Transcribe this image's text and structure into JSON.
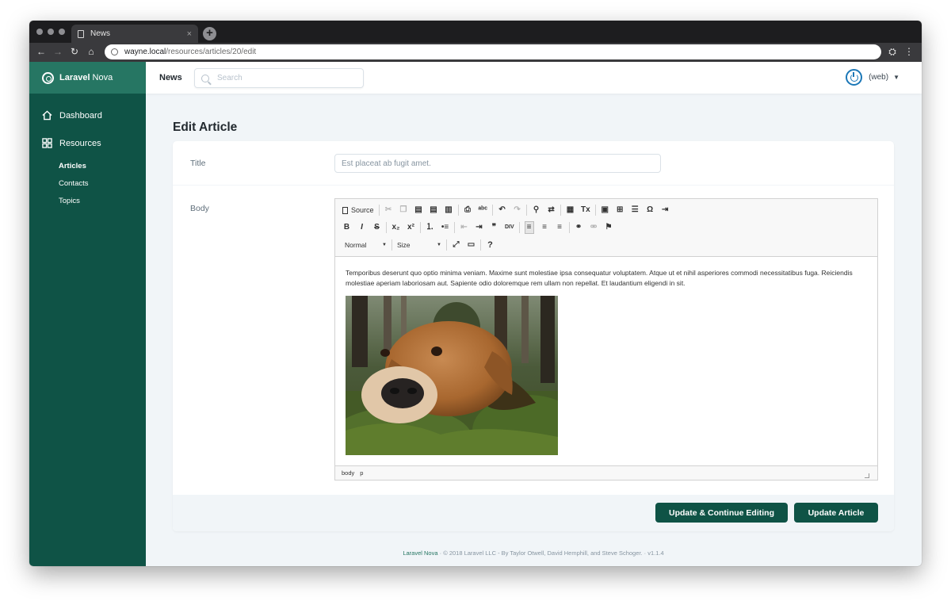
{
  "browser": {
    "tab_title": "News",
    "tab_close": "×",
    "new_tab": "+",
    "url_host": "wayne.local",
    "url_path": "/resources/articles/20/edit",
    "nav": {
      "back": "←",
      "forward": "→",
      "reload": "↻",
      "home": "⌂",
      "menu": "⋮",
      "incognito": "⛭"
    }
  },
  "brand": {
    "name_bold": "Laravel",
    "name_light": "Nova"
  },
  "sidebar": {
    "dashboard": "Dashboard",
    "resources": "Resources",
    "items": [
      {
        "label": "Articles",
        "active": true
      },
      {
        "label": "Contacts",
        "active": false
      },
      {
        "label": "Topics",
        "active": false
      }
    ]
  },
  "header": {
    "title": "News",
    "search_placeholder": "Search",
    "user_label": "(web)",
    "caret": "⌄",
    "accent": "#1b77b7"
  },
  "page": {
    "title": "Edit Article"
  },
  "form": {
    "title_label": "Title",
    "title_value": "Est placeat ab fugit amet.",
    "body_label": "Body",
    "body_text": "Temporibus deserunt quo optio minima veniam. Maxime sunt molestiae ipsa consequatur voluptatem. Atque ut et nihil asperiores commodi necessitatibus fuga. Reiciendis molestiae aperiam laboriosam aut. Sapiente odio doloremque rem ullam non repellat. Et laudantium eligendi in sit."
  },
  "editor": {
    "source_label": "Source",
    "format_value": "Normal",
    "size_value": "Size",
    "status_path": [
      "body",
      "p"
    ],
    "icons": {
      "cut": "✂",
      "copy": "❐",
      "paste": "📋",
      "paste_text": "▤",
      "paste_word": "▥",
      "print": "⎙",
      "spell": "ᵃᵇᶜ",
      "undo": "↶",
      "redo": "↷",
      "find": "⚲",
      "replace": "⇄",
      "select_all": "▦",
      "remove_format": "Tx",
      "image": "▣",
      "table": "⊞",
      "hr": "☰",
      "special": "Ω",
      "indent_list": "⇥",
      "bold": "B",
      "italic": "I",
      "strike": "S",
      "sub": "x₂",
      "sup": "x²",
      "ol": "⒈",
      "ul": "•≡",
      "outdent": "⇤",
      "indent": "⇥",
      "quote": "❞",
      "div": "DIV",
      "align_left": "≡",
      "align_center": "≡",
      "align_right": "≡",
      "link": "⚭",
      "unlink": "⚮",
      "anchor": "⚑",
      "maximize": "⤢",
      "blocks": "▭",
      "about": "?"
    }
  },
  "buttons": {
    "update_continue": "Update & Continue Editing",
    "update": "Update Article"
  },
  "footer": {
    "brand": "Laravel Nova",
    "copyright": "© 2018 Laravel LLC - By Taylor Otwell, David Hemphill, and Steve Schoger.",
    "version": "v1.1.4",
    "separator": "·"
  },
  "colors": {
    "sidebar": "#0f5346",
    "brand_bar": "#267663",
    "button": "#0f5346"
  }
}
